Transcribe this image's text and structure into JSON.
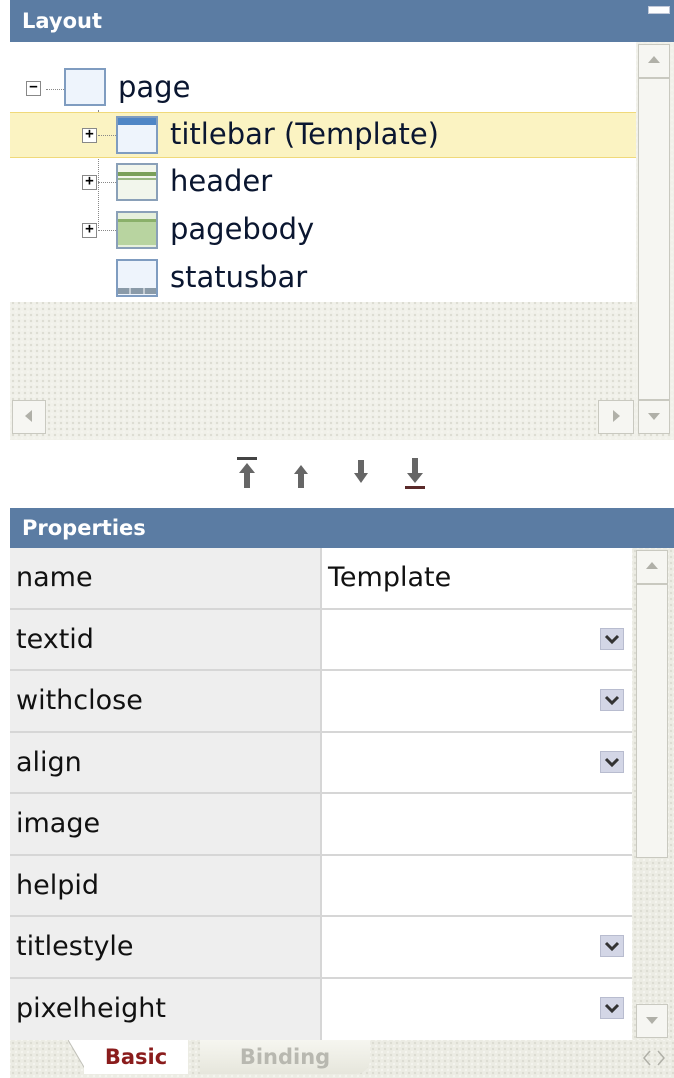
{
  "layout_panel": {
    "title": "Layout",
    "tree": [
      {
        "label": "page",
        "toggle": "−"
      },
      {
        "label": "titlebar (Template)",
        "toggle": "+",
        "selected": true
      },
      {
        "label": "header",
        "toggle": "+"
      },
      {
        "label": "pagebody",
        "toggle": "+"
      },
      {
        "label": "statusbar",
        "toggle": ""
      }
    ],
    "order_controls": [
      "move-to-top",
      "move-up",
      "move-down",
      "move-to-bottom"
    ]
  },
  "properties_panel": {
    "title": "Properties",
    "rows": [
      {
        "name": "name",
        "value": "Template",
        "dropdown": false
      },
      {
        "name": "textid",
        "value": "",
        "dropdown": true
      },
      {
        "name": "withclose",
        "value": "",
        "dropdown": true
      },
      {
        "name": "align",
        "value": "",
        "dropdown": true
      },
      {
        "name": "image",
        "value": "",
        "dropdown": false
      },
      {
        "name": "helpid",
        "value": "",
        "dropdown": false
      },
      {
        "name": "titlestyle",
        "value": "",
        "dropdown": true
      },
      {
        "name": "pixelheight",
        "value": "",
        "dropdown": true
      }
    ],
    "tabs": [
      {
        "label": "Basic",
        "active": true
      },
      {
        "label": "Binding",
        "active": false
      }
    ]
  },
  "colors": {
    "header_bg": "#5b7ca3",
    "selected_row": "#fbf3c2",
    "active_tab_text": "#8a1c1c"
  }
}
